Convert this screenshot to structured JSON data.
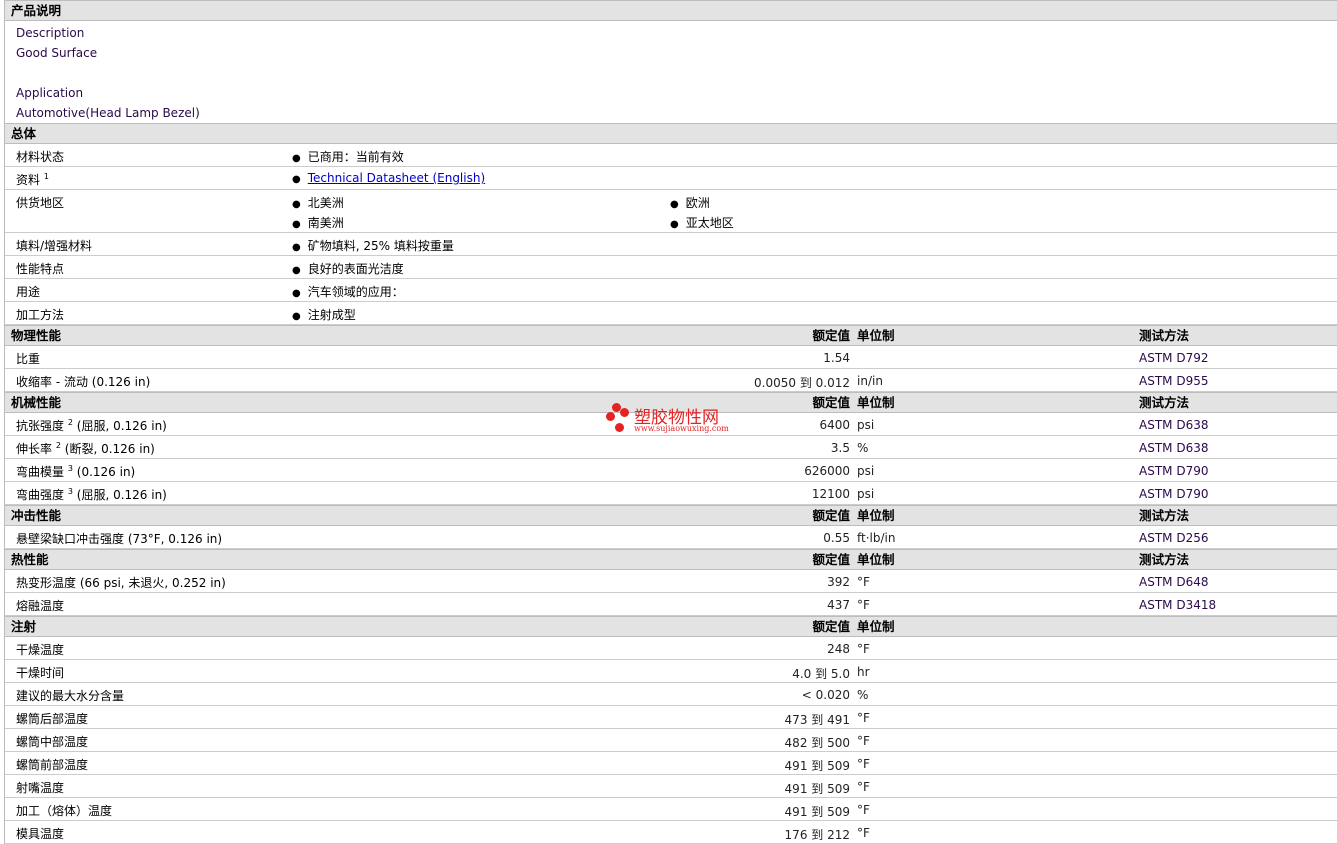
{
  "description": {
    "title": "产品说明",
    "lines": [
      "Description",
      "Good Surface",
      "",
      "Application",
      "Automotive(Head Lamp Bezel)"
    ]
  },
  "general": {
    "title": "总体",
    "rows": [
      {
        "label": "材料状态",
        "items": [
          "已商用：当前有效"
        ]
      },
      {
        "label": "资料",
        "sup": "1",
        "link": "Technical Datasheet (English)"
      },
      {
        "label": "供货地区",
        "items": [
          "北美洲",
          "欧洲",
          "南美洲",
          "亚太地区"
        ],
        "grid": true
      },
      {
        "label": "填料/增强材料",
        "items": [
          "矿物填料, 25% 填料按重量"
        ]
      },
      {
        "label": "性能特点",
        "items": [
          "良好的表面光洁度"
        ]
      },
      {
        "label": "用途",
        "items": [
          "汽车领域的应用："
        ]
      },
      {
        "label": "加工方法",
        "items": [
          "注射成型"
        ]
      }
    ]
  },
  "columns": {
    "value": "额定值",
    "unit": "单位制",
    "method": "测试方法"
  },
  "sections": [
    {
      "title": "物理性能",
      "method": true,
      "rows": [
        {
          "label": "比重",
          "value": "1.54",
          "unit": "",
          "method": "ASTM D792"
        },
        {
          "label": "收缩率 - 流动 (0.126 in)",
          "value": "0.0050 到  0.012",
          "unit": "in/in",
          "method": "ASTM D955"
        }
      ]
    },
    {
      "title": "机械性能",
      "method": true,
      "rows": [
        {
          "label": "抗张强度",
          "sup": "2",
          "label2": "(屈服, 0.126 in)",
          "value": "6400",
          "unit": "psi",
          "method": "ASTM D638"
        },
        {
          "label": "伸长率",
          "sup": "2",
          "label2": "(断裂, 0.126 in)",
          "value": "3.5",
          "unit": "%",
          "method": "ASTM D638"
        },
        {
          "label": "弯曲模量",
          "sup": "3",
          "label2": "(0.126 in)",
          "value": "626000",
          "unit": "psi",
          "method": "ASTM D790"
        },
        {
          "label": "弯曲强度",
          "sup": "3",
          "label2": "(屈服, 0.126 in)",
          "value": "12100",
          "unit": "psi",
          "method": "ASTM D790"
        }
      ]
    },
    {
      "title": "冲击性能",
      "method": true,
      "rows": [
        {
          "label": "悬壁梁缺口冲击强度 (73°F, 0.126 in)",
          "value": "0.55",
          "unit": "ft·lb/in",
          "method": "ASTM D256"
        }
      ]
    },
    {
      "title": "热性能",
      "method": true,
      "rows": [
        {
          "label": "热变形温度 (66 psi, 未退火, 0.252 in)",
          "value": "392",
          "unit": "°F",
          "method": "ASTM D648"
        },
        {
          "label": "熔融温度",
          "value": "437",
          "unit": "°F",
          "method": "ASTM D3418"
        }
      ]
    },
    {
      "title": "注射",
      "method": false,
      "rows": [
        {
          "label": "干燥温度",
          "value": "248",
          "unit": "°F"
        },
        {
          "label": "干燥时间",
          "value": "4.0 到  5.0",
          "unit": "hr"
        },
        {
          "label": "建议的最大水分含量",
          "value": "< 0.020",
          "unit": "%"
        },
        {
          "label": "螺筒后部温度",
          "value": "473 到  491",
          "unit": "°F"
        },
        {
          "label": "螺筒中部温度",
          "value": "482 到  500",
          "unit": "°F"
        },
        {
          "label": "螺筒前部温度",
          "value": "491 到  509",
          "unit": "°F"
        },
        {
          "label": "射嘴温度",
          "value": "491 到  509",
          "unit": "°F"
        },
        {
          "label": "加工（熔体）温度",
          "value": "491 到  509",
          "unit": "°F"
        },
        {
          "label": "模具温度",
          "value": "176 到  212",
          "unit": "°F"
        }
      ]
    }
  ],
  "watermark": {
    "name": "塑胶物性网",
    "url": "www.sujiaowuxing.com"
  }
}
